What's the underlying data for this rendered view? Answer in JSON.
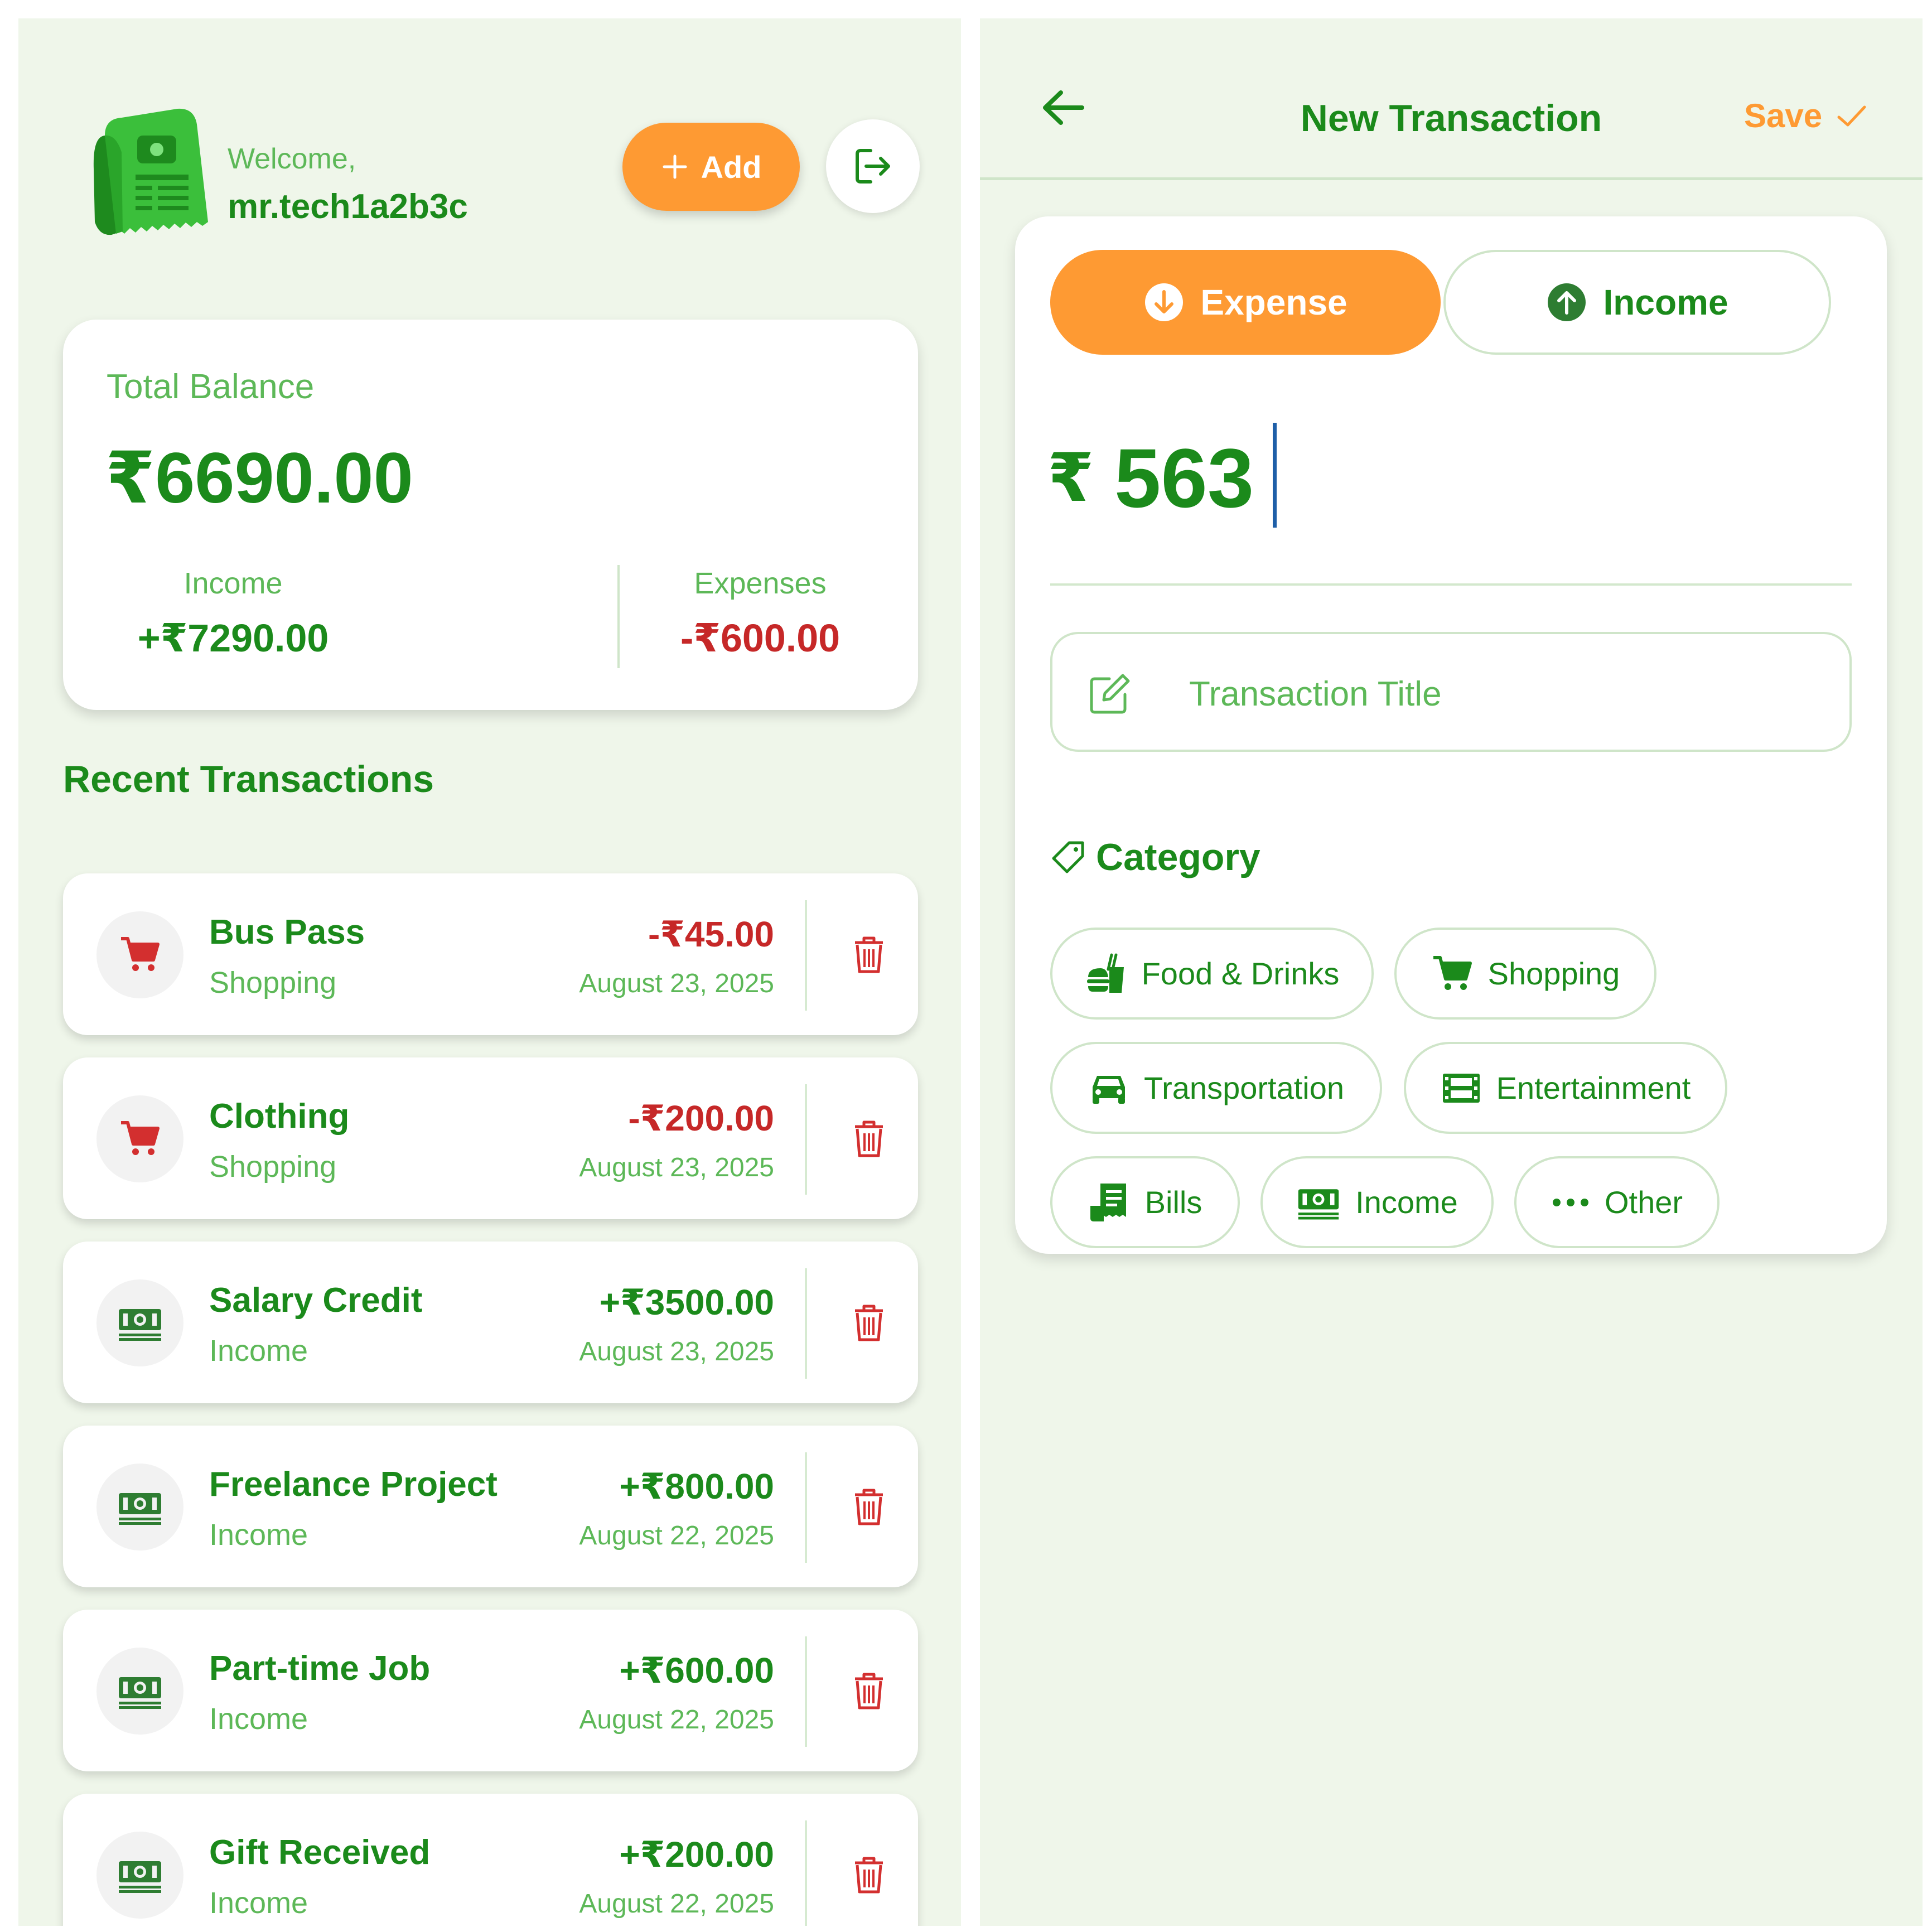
{
  "left": {
    "header": {
      "welcome": "Welcome,",
      "username": "mr.tech1a2b3c",
      "add_label": "Add"
    },
    "balance": {
      "title": "Total Balance",
      "amount": "₹6690.00",
      "income_label": "Income",
      "income_value": "+₹7290.00",
      "expenses_label": "Expenses",
      "expenses_value": "-₹600.00"
    },
    "recent_title": "Recent Transactions",
    "transactions": [
      {
        "title": "Bus Pass",
        "category": "Shopping",
        "amount": "-₹45.00",
        "date": "August 23, 2025"
      },
      {
        "title": "Clothing",
        "category": "Shopping",
        "amount": "-₹200.00",
        "date": "August 23, 2025"
      },
      {
        "title": "Salary Credit",
        "category": "Income",
        "amount": "+₹3500.00",
        "date": "August 23, 2025"
      },
      {
        "title": "Freelance Project",
        "category": "Income",
        "amount": "+₹800.00",
        "date": "August 22, 2025"
      },
      {
        "title": "Part-time Job",
        "category": "Income",
        "amount": "+₹600.00",
        "date": "August 22, 2025"
      },
      {
        "title": "Gift Received",
        "category": "Income",
        "amount": "+₹200.00",
        "date": "August 22, 2025"
      }
    ]
  },
  "right": {
    "title": "New Transaction",
    "save_label": "Save",
    "type_expense": "Expense",
    "type_income": "Income",
    "currency_symbol": "₹",
    "amount_value": "563",
    "title_placeholder": "Transaction Title",
    "category_label": "Category",
    "categories": [
      "Food & Drinks",
      "Shopping",
      "Transportation",
      "Entertainment",
      "Bills",
      "Income",
      "Other"
    ]
  },
  "colors": {
    "primary_green": "#1b8a1b",
    "light_green": "#5db858",
    "background": "#eff6ea",
    "accent_orange": "#fe9a33",
    "expense_red": "#c62828"
  },
  "icons": [
    "receipt-logo-icon",
    "plus-icon",
    "logout-icon",
    "cart-icon",
    "money-icon",
    "trash-icon",
    "back-arrow-icon",
    "check-icon",
    "arrow-down-circle-icon",
    "arrow-up-circle-icon",
    "edit-icon",
    "tag-icon",
    "food-icon",
    "car-icon",
    "film-icon",
    "bills-icon",
    "more-dots-icon"
  ]
}
